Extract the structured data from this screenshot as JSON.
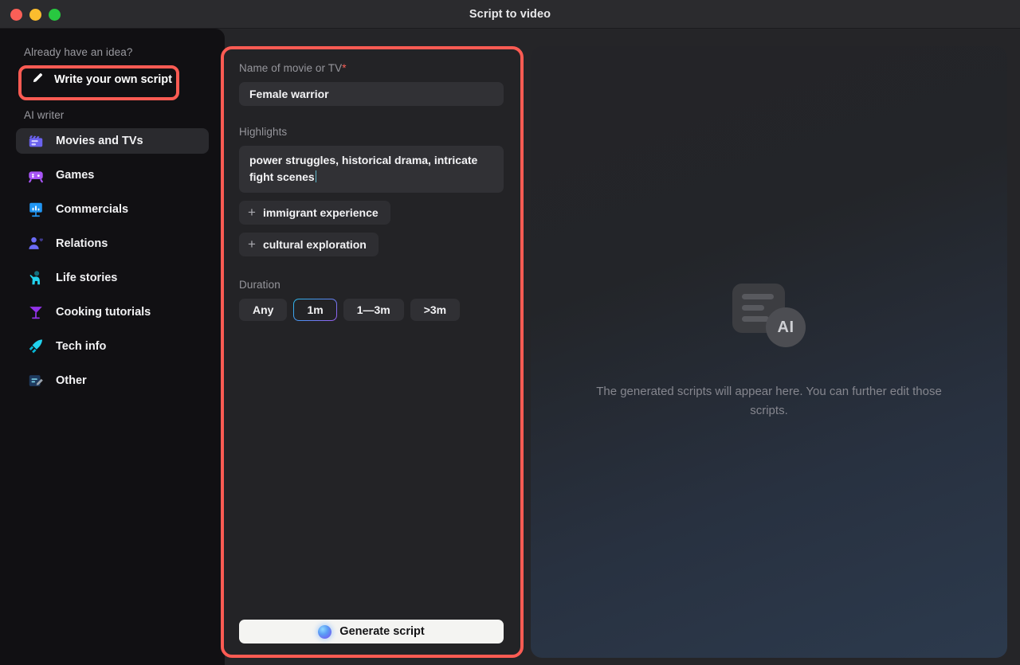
{
  "window": {
    "title": "Script to video",
    "traffic_lights": [
      {
        "name": "close",
        "color": "#fa5f57"
      },
      {
        "name": "minimize",
        "color": "#fbbd2e"
      },
      {
        "name": "maximize",
        "color": "#28c840"
      }
    ]
  },
  "sidebar": {
    "idea_label": "Already have an idea?",
    "own_script_label": "Write your own script",
    "own_script_icon": "pencil-icon",
    "ai_writer_label": "AI writer",
    "items": [
      {
        "label": "Movies and TVs",
        "icon": "clapperboard-icon",
        "active": true
      },
      {
        "label": "Games",
        "icon": "gamepad-icon",
        "active": false
      },
      {
        "label": "Commercials",
        "icon": "presentation-icon",
        "active": false
      },
      {
        "label": "Relations",
        "icon": "person-heart-icon",
        "active": false
      },
      {
        "label": "Life stories",
        "icon": "person-wave-icon",
        "active": false
      },
      {
        "label": "Cooking tutorials",
        "icon": "cocktail-icon",
        "active": false
      },
      {
        "label": "Tech info",
        "icon": "rocket-icon",
        "active": false
      },
      {
        "label": "Other",
        "icon": "note-edit-icon",
        "active": false
      }
    ]
  },
  "form": {
    "name_label": "Name of movie or TV",
    "name_required_marker": "*",
    "name_value": "Female warrior",
    "highlights_label": "Highlights",
    "highlights_value": "power struggles, historical drama, intricate fight scenes",
    "suggestions": [
      {
        "label": "immigrant experience",
        "icon": "plus-icon"
      },
      {
        "label": "cultural exploration",
        "icon": "plus-icon"
      }
    ],
    "duration_label": "Duration",
    "duration_options": [
      {
        "label": "Any",
        "selected": false
      },
      {
        "label": "1m",
        "selected": true
      },
      {
        "label": "1—3m",
        "selected": false
      },
      {
        "label": ">3m",
        "selected": false
      }
    ],
    "generate_label": "Generate script",
    "generate_icon": "sparkle-orb-icon"
  },
  "preview": {
    "placeholder_text": "The generated scripts will appear here. You can further edit those scripts.",
    "badge_text": "AI",
    "icon": "ai-document-icon"
  },
  "annotations": {
    "highlight_color": "#fc5b53",
    "boxes": [
      {
        "name": "write-your-own-script-highlight"
      },
      {
        "name": "script-form-highlight"
      }
    ]
  },
  "colors": {
    "accent_gradient_start": "#2bb9e8",
    "accent_gradient_end": "#9b5cf0",
    "sidebar_bg": "#111013",
    "panel_bg": "#232326",
    "app_bg": "#252528"
  }
}
